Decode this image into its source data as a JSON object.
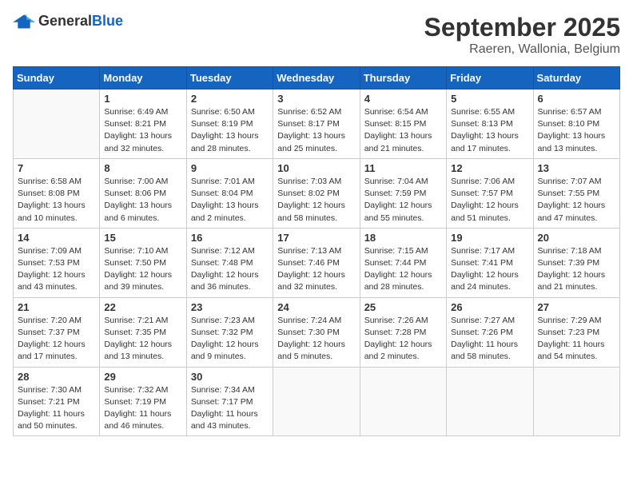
{
  "logo": {
    "general": "General",
    "blue": "Blue"
  },
  "header": {
    "month": "September 2025",
    "location": "Raeren, Wallonia, Belgium"
  },
  "weekdays": [
    "Sunday",
    "Monday",
    "Tuesday",
    "Wednesday",
    "Thursday",
    "Friday",
    "Saturday"
  ],
  "weeks": [
    [
      {
        "day": "",
        "info": ""
      },
      {
        "day": "1",
        "info": "Sunrise: 6:49 AM\nSunset: 8:21 PM\nDaylight: 13 hours\nand 32 minutes."
      },
      {
        "day": "2",
        "info": "Sunrise: 6:50 AM\nSunset: 8:19 PM\nDaylight: 13 hours\nand 28 minutes."
      },
      {
        "day": "3",
        "info": "Sunrise: 6:52 AM\nSunset: 8:17 PM\nDaylight: 13 hours\nand 25 minutes."
      },
      {
        "day": "4",
        "info": "Sunrise: 6:54 AM\nSunset: 8:15 PM\nDaylight: 13 hours\nand 21 minutes."
      },
      {
        "day": "5",
        "info": "Sunrise: 6:55 AM\nSunset: 8:13 PM\nDaylight: 13 hours\nand 17 minutes."
      },
      {
        "day": "6",
        "info": "Sunrise: 6:57 AM\nSunset: 8:10 PM\nDaylight: 13 hours\nand 13 minutes."
      }
    ],
    [
      {
        "day": "7",
        "info": "Sunrise: 6:58 AM\nSunset: 8:08 PM\nDaylight: 13 hours\nand 10 minutes."
      },
      {
        "day": "8",
        "info": "Sunrise: 7:00 AM\nSunset: 8:06 PM\nDaylight: 13 hours\nand 6 minutes."
      },
      {
        "day": "9",
        "info": "Sunrise: 7:01 AM\nSunset: 8:04 PM\nDaylight: 13 hours\nand 2 minutes."
      },
      {
        "day": "10",
        "info": "Sunrise: 7:03 AM\nSunset: 8:02 PM\nDaylight: 12 hours\nand 58 minutes."
      },
      {
        "day": "11",
        "info": "Sunrise: 7:04 AM\nSunset: 7:59 PM\nDaylight: 12 hours\nand 55 minutes."
      },
      {
        "day": "12",
        "info": "Sunrise: 7:06 AM\nSunset: 7:57 PM\nDaylight: 12 hours\nand 51 minutes."
      },
      {
        "day": "13",
        "info": "Sunrise: 7:07 AM\nSunset: 7:55 PM\nDaylight: 12 hours\nand 47 minutes."
      }
    ],
    [
      {
        "day": "14",
        "info": "Sunrise: 7:09 AM\nSunset: 7:53 PM\nDaylight: 12 hours\nand 43 minutes."
      },
      {
        "day": "15",
        "info": "Sunrise: 7:10 AM\nSunset: 7:50 PM\nDaylight: 12 hours\nand 39 minutes."
      },
      {
        "day": "16",
        "info": "Sunrise: 7:12 AM\nSunset: 7:48 PM\nDaylight: 12 hours\nand 36 minutes."
      },
      {
        "day": "17",
        "info": "Sunrise: 7:13 AM\nSunset: 7:46 PM\nDaylight: 12 hours\nand 32 minutes."
      },
      {
        "day": "18",
        "info": "Sunrise: 7:15 AM\nSunset: 7:44 PM\nDaylight: 12 hours\nand 28 minutes."
      },
      {
        "day": "19",
        "info": "Sunrise: 7:17 AM\nSunset: 7:41 PM\nDaylight: 12 hours\nand 24 minutes."
      },
      {
        "day": "20",
        "info": "Sunrise: 7:18 AM\nSunset: 7:39 PM\nDaylight: 12 hours\nand 21 minutes."
      }
    ],
    [
      {
        "day": "21",
        "info": "Sunrise: 7:20 AM\nSunset: 7:37 PM\nDaylight: 12 hours\nand 17 minutes."
      },
      {
        "day": "22",
        "info": "Sunrise: 7:21 AM\nSunset: 7:35 PM\nDaylight: 12 hours\nand 13 minutes."
      },
      {
        "day": "23",
        "info": "Sunrise: 7:23 AM\nSunset: 7:32 PM\nDaylight: 12 hours\nand 9 minutes."
      },
      {
        "day": "24",
        "info": "Sunrise: 7:24 AM\nSunset: 7:30 PM\nDaylight: 12 hours\nand 5 minutes."
      },
      {
        "day": "25",
        "info": "Sunrise: 7:26 AM\nSunset: 7:28 PM\nDaylight: 12 hours\nand 2 minutes."
      },
      {
        "day": "26",
        "info": "Sunrise: 7:27 AM\nSunset: 7:26 PM\nDaylight: 11 hours\nand 58 minutes."
      },
      {
        "day": "27",
        "info": "Sunrise: 7:29 AM\nSunset: 7:23 PM\nDaylight: 11 hours\nand 54 minutes."
      }
    ],
    [
      {
        "day": "28",
        "info": "Sunrise: 7:30 AM\nSunset: 7:21 PM\nDaylight: 11 hours\nand 50 minutes."
      },
      {
        "day": "29",
        "info": "Sunrise: 7:32 AM\nSunset: 7:19 PM\nDaylight: 11 hours\nand 46 minutes."
      },
      {
        "day": "30",
        "info": "Sunrise: 7:34 AM\nSunset: 7:17 PM\nDaylight: 11 hours\nand 43 minutes."
      },
      {
        "day": "",
        "info": ""
      },
      {
        "day": "",
        "info": ""
      },
      {
        "day": "",
        "info": ""
      },
      {
        "day": "",
        "info": ""
      }
    ]
  ]
}
